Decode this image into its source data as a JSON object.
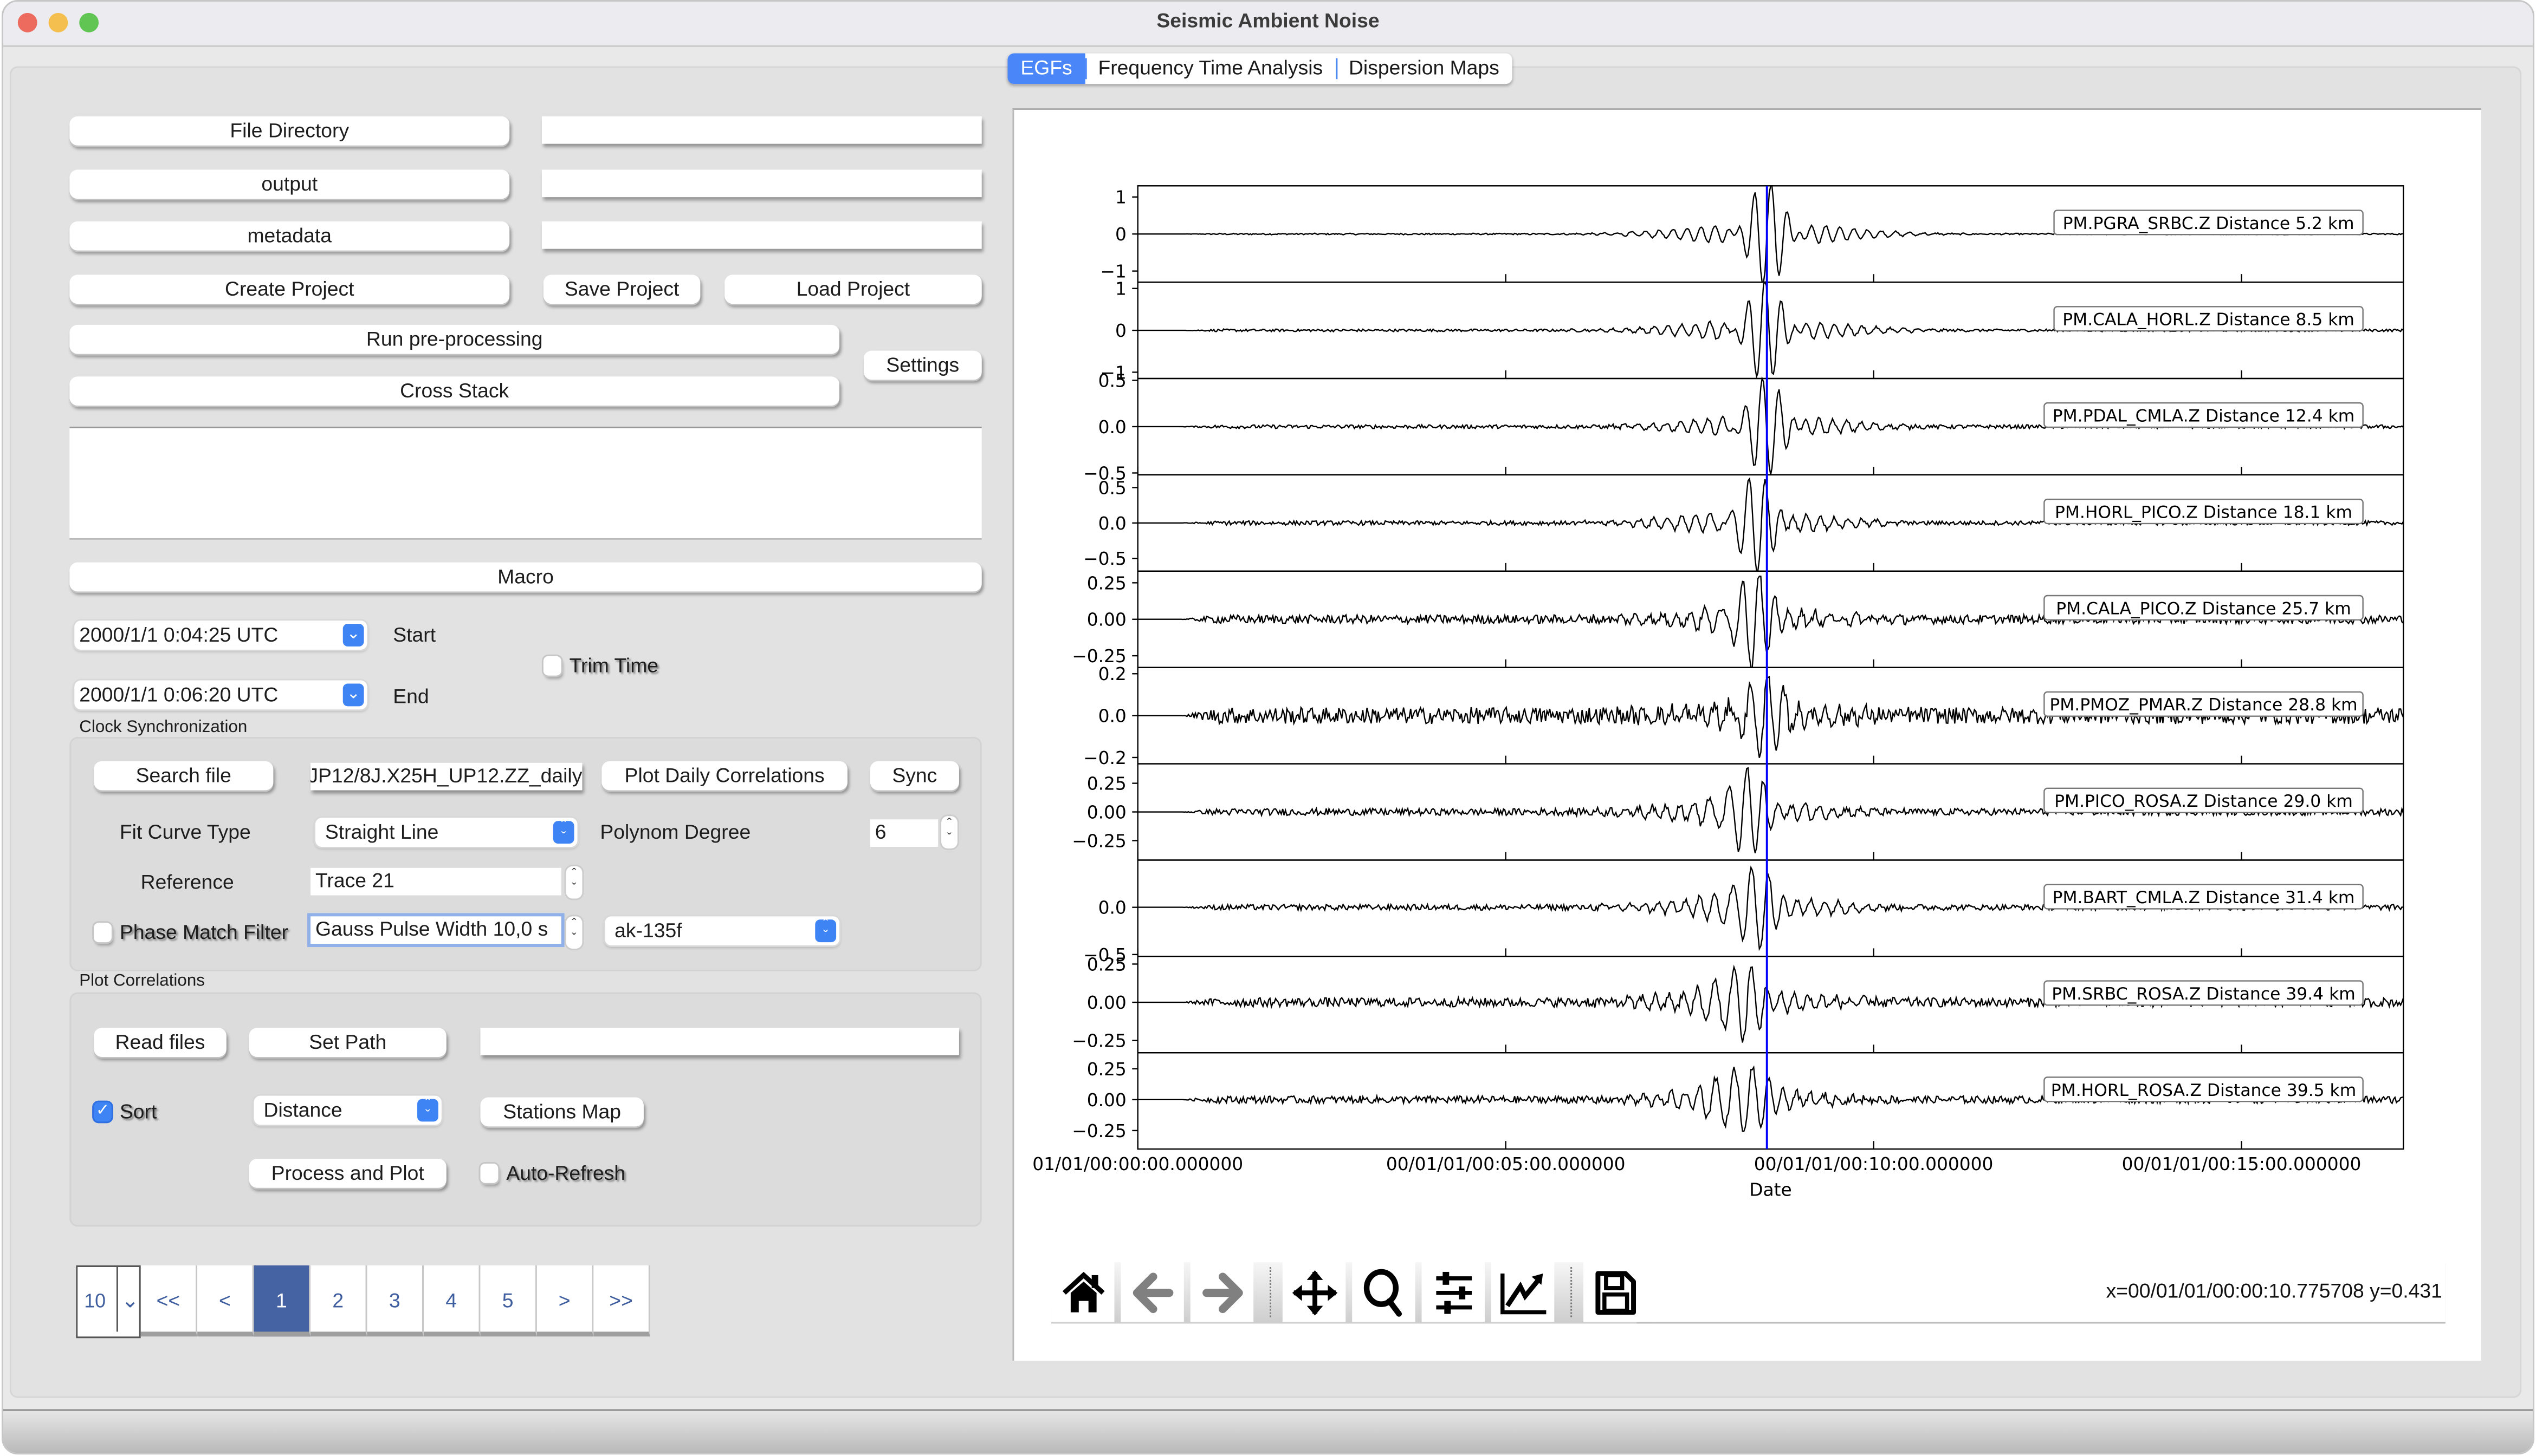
{
  "window": {
    "title": "Seismic Ambient Noise",
    "traffic_lights": {
      "close": "#ed6a5e",
      "minimize": "#f4bf4f",
      "zoom": "#61c554"
    }
  },
  "tabs": [
    {
      "label": "EGFs",
      "active": true
    },
    {
      "label": "Frequency Time Analysis",
      "active": false
    },
    {
      "label": "Dispersion Maps",
      "active": false
    }
  ],
  "project": {
    "file_directory_label": "File Directory",
    "file_directory_value": "",
    "output_label": "output",
    "output_value": "",
    "metadata_label": "metadata",
    "metadata_value": "",
    "create_project_label": "Create Project",
    "save_project_label": "Save Project",
    "load_project_label": "Load Project",
    "run_preprocessing_label": "Run pre-processing",
    "cross_stack_label": "Cross  Stack",
    "settings_label": "Settings",
    "log_text": "",
    "macro_label": "Macro"
  },
  "time": {
    "start_value": "2000/1/1 0:04:25 UTC",
    "start_label": "Start",
    "end_value": "2000/1/1 0:06:20 UTC",
    "end_label": "End",
    "trim_time_label": "Trim Time",
    "trim_time_checked": false
  },
  "clock_sync": {
    "group_title": "Clock Synchronization",
    "search_file_label": "Search file",
    "file_value": "JP12/8J.X25H_UP12.ZZ_daily",
    "plot_daily_label": "Plot Daily Correlations",
    "sync_label": "Sync",
    "fit_curve_label": "Fit Curve Type",
    "fit_curve_value": "Straight Line",
    "polynom_degree_label": "Polynom Degree",
    "polynom_degree_value": "6",
    "reference_label": "Reference",
    "reference_value": "Trace 21",
    "phase_match_label": "Phase Match Filter",
    "phase_match_checked": false,
    "gauss_pulse_value": "Gauss Pulse Width 10,0 s",
    "model_value": "ak-135f"
  },
  "plot_correlations": {
    "group_title": "Plot Correlations",
    "read_files_label": "Read files",
    "set_path_label": "Set Path",
    "path_value": "",
    "sort_label": "Sort",
    "sort_checked": true,
    "sort_by_value": "Distance",
    "stations_map_label": "Stations Map",
    "process_plot_label": "Process and Plot",
    "auto_refresh_label": "Auto-Refresh",
    "auto_refresh_checked": false
  },
  "pagination": {
    "page_size": "10",
    "first": "<<",
    "prev": "<",
    "pages": [
      "1",
      "2",
      "3",
      "4",
      "5"
    ],
    "current_page": "1",
    "next": ">",
    "last": ">>"
  },
  "toolbar": {
    "tools": [
      "home-icon",
      "back-arrow-icon",
      "forward-arrow-icon",
      "pan-icon",
      "zoom-magnifier-icon",
      "configure-subplots-icon",
      "edit-axis-icon",
      "save-floppy-icon"
    ],
    "coordinates": "x=00/01/01/00:00:10.775708 y=0.431"
  },
  "chart_data": {
    "type": "line",
    "title": "",
    "xlabel": "Date",
    "x_tick_labels": [
      "01/01/00:00:00.000000",
      "00/01/01/00:05:00.000000",
      "00/01/01/00:10:00.000000",
      "00/01/01/00:15:00.000000"
    ],
    "x_range_minutes": [
      0,
      17.2
    ],
    "x_tick_positions_minutes": [
      0,
      5,
      10,
      15
    ],
    "marker_line": {
      "x_minutes": 8.55,
      "color": "#0000ff"
    },
    "trace_color": "#000000",
    "series": [
      {
        "name": "PM.PGRA_SRBC.Z Distance 5.2 km",
        "ylim": [
          -1.3,
          1.3
        ],
        "yticks": [
          "1",
          "0",
          "−1"
        ],
        "ytick_values": [
          1,
          0,
          -1
        ],
        "peak_amplitude": 1.2,
        "arrival_offset_minutes": 0.0,
        "noise": 0.02
      },
      {
        "name": "PM.CALA_HORL.Z Distance 8.5 km",
        "ylim": [
          -1.15,
          1.15
        ],
        "yticks": [
          "1",
          "0",
          "−1"
        ],
        "ytick_values": [
          1,
          0,
          -1
        ],
        "peak_amplitude": 1.0,
        "arrival_offset_minutes": -0.05,
        "noise": 0.03
      },
      {
        "name": "PM.PDAL_CMLA.Z Distance 12.4 km",
        "ylim": [
          -0.52,
          0.52
        ],
        "yticks": [
          "0.5",
          "0.0",
          "−0.5"
        ],
        "ytick_values": [
          0.5,
          0,
          -0.5
        ],
        "peak_amplitude": 0.45,
        "arrival_offset_minutes": -0.05,
        "noise": 0.02
      },
      {
        "name": "PM.HORL_PICO.Z Distance 18.1 km",
        "ylim": [
          -0.68,
          0.68
        ],
        "yticks": [
          "0.5",
          "0.0",
          "−0.5"
        ],
        "ytick_values": [
          0.5,
          0,
          -0.5
        ],
        "peak_amplitude": 0.6,
        "arrival_offset_minutes": -0.2,
        "noise": 0.03
      },
      {
        "name": "PM.CALA_PICO.Z Distance 25.7 km",
        "ylim": [
          -0.33,
          0.33
        ],
        "yticks": [
          "0.25",
          "0.00",
          "−0.25"
        ],
        "ytick_values": [
          0.25,
          0,
          -0.25
        ],
        "peak_amplitude": 0.3,
        "arrival_offset_minutes": -0.25,
        "noise": 0.03
      },
      {
        "name": "PM.PMOZ_PMAR.Z Distance 28.8 km",
        "ylim": [
          -0.23,
          0.23
        ],
        "yticks": [
          "0.2",
          "0.0",
          "−0.2"
        ],
        "ytick_values": [
          0.2,
          0,
          -0.2
        ],
        "peak_amplitude": 0.2,
        "arrival_offset_minutes": -0.1,
        "noise": 0.04
      },
      {
        "name": "PM.PICO_ROSA.Z Distance 29.0 km",
        "ylim": [
          -0.42,
          0.42
        ],
        "yticks": [
          "0.25",
          "0.00",
          "−0.25"
        ],
        "ytick_values": [
          0.25,
          0,
          -0.25
        ],
        "peak_amplitude": 0.37,
        "arrival_offset_minutes": -0.35,
        "noise": 0.03
      },
      {
        "name": "PM.BART_CMLA.Z Distance 31.4 km",
        "ylim": [
          -0.52,
          0.5
        ],
        "yticks": [
          "0.0",
          "−0.5"
        ],
        "ytick_values": [
          0,
          -0.5
        ],
        "peak_amplitude": 0.45,
        "arrival_offset_minutes": -0.25,
        "noise": 0.03
      },
      {
        "name": "PM.SRBC_ROSA.Z Distance 39.4 km",
        "ylim": [
          -0.33,
          0.3
        ],
        "yticks": [
          "0.25",
          "0.00",
          "−0.25"
        ],
        "ytick_values": [
          0.25,
          0,
          -0.25
        ],
        "peak_amplitude": 0.28,
        "arrival_offset_minutes": -0.45,
        "noise": 0.03
      },
      {
        "name": "PM.HORL_ROSA.Z Distance 39.5 km",
        "ylim": [
          -0.4,
          0.38
        ],
        "yticks": [
          "0.25",
          "0.00",
          "−0.25"
        ],
        "ytick_values": [
          0.25,
          0,
          -0.25
        ],
        "peak_amplitude": 0.33,
        "arrival_offset_minutes": -0.4,
        "noise": 0.03
      }
    ]
  }
}
